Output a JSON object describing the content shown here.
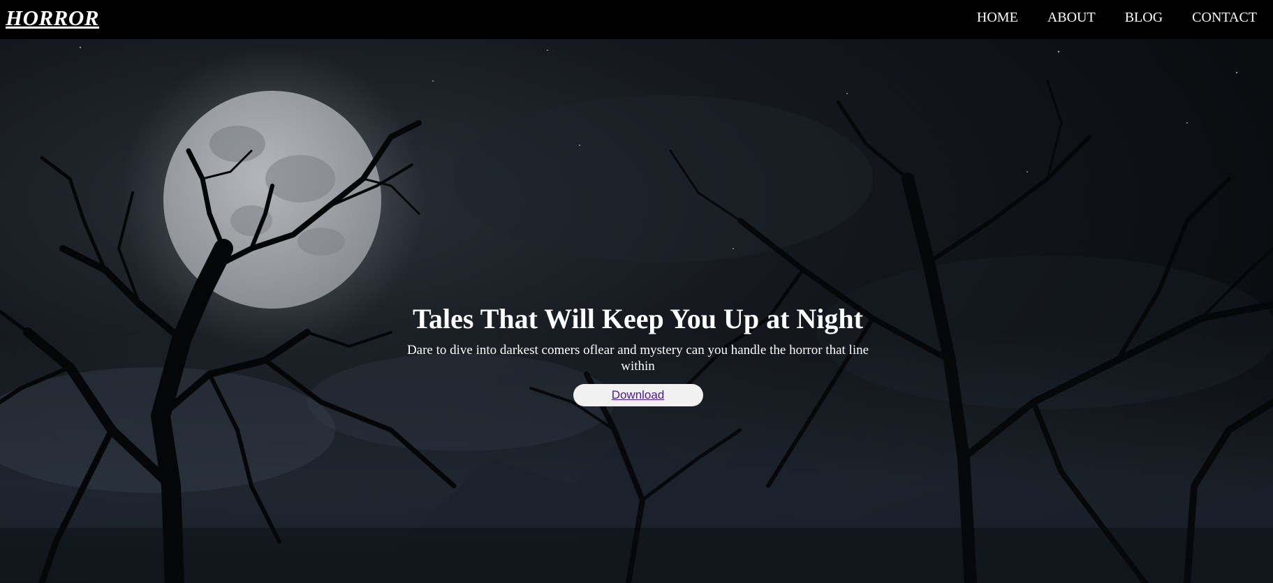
{
  "header": {
    "logo": "HORROR",
    "nav": [
      {
        "label": "HOME"
      },
      {
        "label": "ABOUT"
      },
      {
        "label": "BLOG"
      },
      {
        "label": "CONTACT"
      }
    ]
  },
  "hero": {
    "title": "Tales That Will Keep You Up at Night",
    "subtitle": "Dare to dive into darkest comers oflear and mystery can you handle the horror that line within",
    "button_label": "Download",
    "background_image": "night-forest-moon"
  },
  "colors": {
    "navbar_bg": "#000000",
    "text": "#ffffff",
    "button_bg": "#f1f1f1",
    "button_text": "#4b1a8a"
  }
}
